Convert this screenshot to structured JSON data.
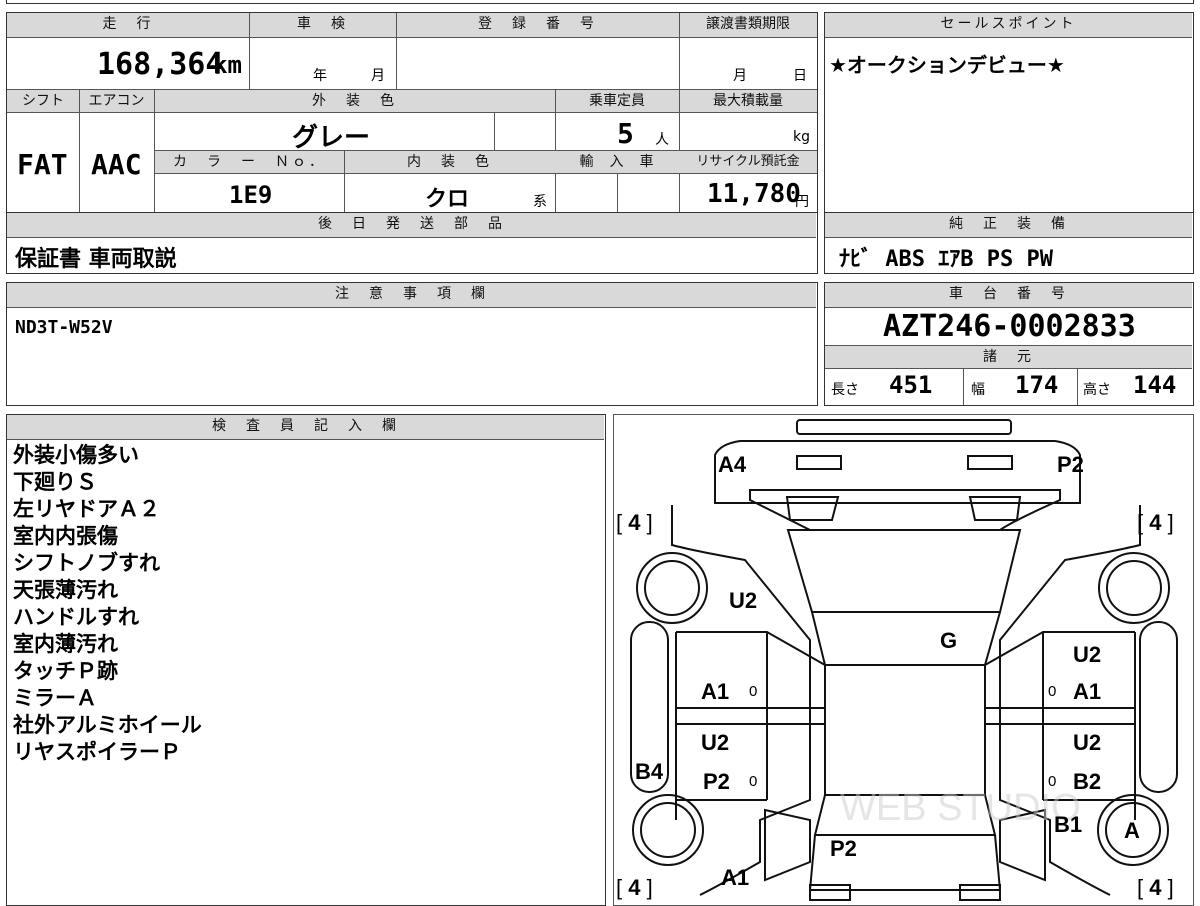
{
  "top_sheet": {
    "labels": {
      "mileage": "走　行",
      "inspection": "車　検",
      "registration": "登　録　番　号",
      "transfer_deadline": "譲渡書類期限",
      "sales_point": "セールスポイント",
      "shift": "シフト",
      "aircon": "エアコン",
      "exterior_color": "外　装　色",
      "capacity": "乗車定員",
      "max_load": "最大積載量",
      "color_no": "カ　ラ　ー　Ｎｏ．",
      "interior_color": "内　装　色",
      "import": "輸　入　車",
      "recycle_fee": "リサイクル預託金",
      "later_parts": "後　日　発　送　部　品",
      "genuine_equipment": "純　正　装　備",
      "notes": "注　意　事　項　欄",
      "chassis_no": "車　台　番　号",
      "specs": "諸　元",
      "inspector_notes": "検　査　員　記　入　欄"
    },
    "mileage": "168,364",
    "mileage_unit": "km",
    "inspection_year_unit": "年",
    "inspection_month_unit": "月",
    "transfer_month_unit": "月",
    "transfer_day_unit": "日",
    "sales_point_text": "★オークションデビュー★",
    "shift": "FAT",
    "aircon": "AAC",
    "exterior_color": "グレー",
    "capacity": "5",
    "capacity_unit": "人",
    "max_load_unit": "kg",
    "color_no": "1E9",
    "interior_color": "クロ",
    "interior_suffix": "系",
    "recycle_fee": "11,780",
    "recycle_unit": "円",
    "later_parts_text": "保証書 車両取説",
    "genuine_equipment_text": "ﾅﾋﾞ ABS ｴｱB PS PW",
    "notes_text": "ND3T-W52V",
    "chassis_no": "AZT246-0002833",
    "length_label": "長さ",
    "length": "451",
    "width_label": "幅",
    "width": "174",
    "height_label": "高さ",
    "height": "144"
  },
  "inspector_lines": [
    "外装小傷多い",
    "下廻りＳ",
    "左リヤドアＡ２",
    "室内内張傷",
    "シフトノブすれ",
    "天張薄汚れ",
    "ハンドルすれ",
    "室内薄汚れ",
    "タッチＰ跡",
    "ミラーＡ",
    "社外アルミホイール",
    "リヤスポイラーＰ"
  ],
  "diagram": {
    "marks": {
      "front_left": "A4",
      "front_right": "P2",
      "left_front_fender": "U2",
      "windshield": "G",
      "right_front_door_u": "U2",
      "right_front_door_a": "A1",
      "left_front_door": "A1",
      "left_rear_door_u": "U2",
      "left_rear_door_p": "P2",
      "right_rear_door_u": "U2",
      "right_rear_door_b": "B2",
      "left_side_sill": "B4",
      "right_rear_quarter": "B1",
      "right_rear_wheel": "A",
      "trunk": "P2",
      "rear_bumper": "A1",
      "small_zero": "0"
    },
    "tire_marks": {
      "top_left": "4",
      "top_right": "4",
      "bottom_left": "4",
      "bottom_right": "4"
    },
    "watermark": "WEB STUDIO"
  }
}
